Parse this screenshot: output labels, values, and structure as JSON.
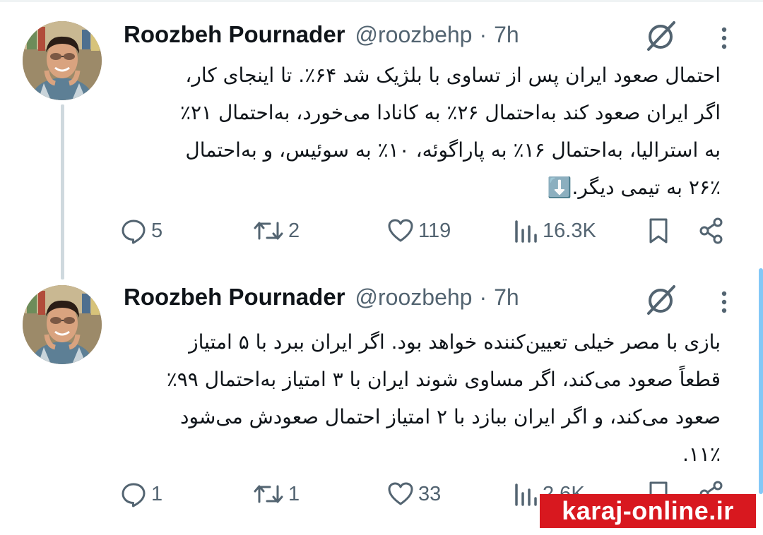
{
  "colors": {
    "text": "#0f1419",
    "muted": "#536471",
    "thread_line": "#cfd9de",
    "watermark_bg": "#d8181f"
  },
  "tweets": [
    {
      "author_name": "Roozbeh Pournader",
      "handle": "@roozbehp",
      "separator": "·",
      "time": "7h",
      "lines": [
        "احتمال صعود ایران پس از تساوی با بلژیک شد ۶۴٪. تا اینجای کار،",
        "اگر ایران صعود کند به‌احتمال ۲۶٪ به کانادا می‌خورد، به‌احتمال ۲۱٪",
        "به استرالیا، به‌احتمال ۱۶٪ به پاراگوئه، ۱۰٪ به سوئیس، و به‌احتمال",
        "۲۶٪ به تیمی دیگر.⬇️"
      ],
      "replies": "5",
      "reposts": "2",
      "likes": "119",
      "views": "16.3K",
      "icons": [
        "avatar-photo",
        "grok-icon",
        "more-icon",
        "reply-icon",
        "repost-icon",
        "like-icon",
        "views-icon",
        "bookmark-icon",
        "share-icon"
      ]
    },
    {
      "author_name": "Roozbeh Pournader",
      "handle": "@roozbehp",
      "separator": "·",
      "time": "7h",
      "lines": [
        "بازی با مصر خیلی تعیین‌کننده خواهد بود. اگر ایران ببرد با ۵ امتیاز",
        "قطعاً صعود می‌کند، اگر مساوی شوند ایران با ۳ امتیاز به‌احتمال ۹۹٪",
        "صعود می‌کند، و اگر ایران ببازد با ۲ امتیاز احتمال صعودش می‌شود",
        "۱۱٪."
      ],
      "replies": "1",
      "reposts": "1",
      "likes": "33",
      "views": "2.6K"
    }
  ],
  "watermark": "karaj-online.ir"
}
